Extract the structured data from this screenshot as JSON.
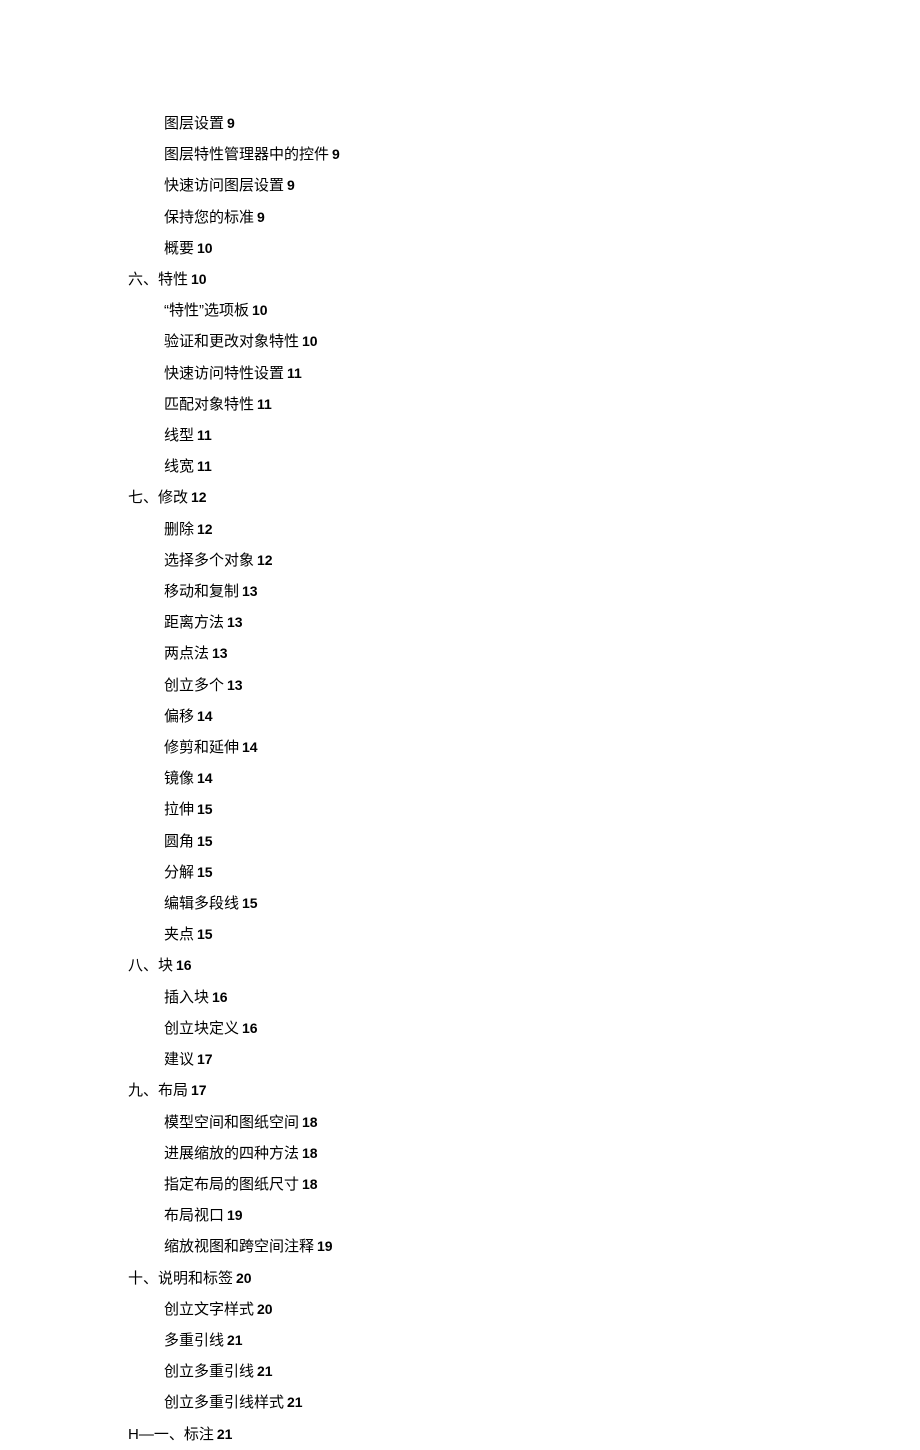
{
  "entries": [
    {
      "level": 1,
      "title": "图层设置",
      "page": "9"
    },
    {
      "level": 1,
      "title": "图层特性管理器中的控件",
      "page": "9"
    },
    {
      "level": 1,
      "title": "快速访问图层设置",
      "page": "9"
    },
    {
      "level": 1,
      "title": "保持您的标准",
      "page": "9"
    },
    {
      "level": 1,
      "title": "概要",
      "page": "10"
    },
    {
      "level": 0,
      "title": "六、特性",
      "page": "10"
    },
    {
      "level": 1,
      "title": "“特性”选项板",
      "page": "10"
    },
    {
      "level": 1,
      "title": "验证和更改对象特性",
      "page": "10"
    },
    {
      "level": 1,
      "title": "快速访问特性设置",
      "page": "11"
    },
    {
      "level": 1,
      "title": "匹配对象特性",
      "page": "11"
    },
    {
      "level": 1,
      "title": "线型",
      "page": "11"
    },
    {
      "level": 1,
      "title": "线宽",
      "page": "11"
    },
    {
      "level": 0,
      "title": "七、修改",
      "page": "12"
    },
    {
      "level": 1,
      "title": "删除",
      "page": "12"
    },
    {
      "level": 1,
      "title": "选择多个对象",
      "page": "12"
    },
    {
      "level": 1,
      "title": "移动和复制",
      "page": "13"
    },
    {
      "level": 1,
      "title": "距离方法",
      "page": "13"
    },
    {
      "level": 1,
      "title": "两点法",
      "page": "13"
    },
    {
      "level": 1,
      "title": "创立多个",
      "page": "13"
    },
    {
      "level": 1,
      "title": "偏移",
      "page": "14"
    },
    {
      "level": 1,
      "title": "修剪和延伸",
      "page": "14"
    },
    {
      "level": 1,
      "title": "镜像",
      "page": "14"
    },
    {
      "level": 1,
      "title": "拉伸",
      "page": "15"
    },
    {
      "level": 1,
      "title": "圆角",
      "page": "15"
    },
    {
      "level": 1,
      "title": "分解",
      "page": "15"
    },
    {
      "level": 1,
      "title": "编辑多段线",
      "page": "15"
    },
    {
      "level": 1,
      "title": "夹点",
      "page": "15"
    },
    {
      "level": 0,
      "title": "八、块",
      "page": "16"
    },
    {
      "level": 1,
      "title": "插入块",
      "page": "16"
    },
    {
      "level": 1,
      "title": "创立块定义",
      "page": "16"
    },
    {
      "level": 1,
      "title": "建议",
      "page": "17"
    },
    {
      "level": 0,
      "title": "九、布局",
      "page": "17"
    },
    {
      "level": 1,
      "title": "模型空间和图纸空间",
      "page": "18"
    },
    {
      "level": 1,
      "title": "进展缩放的四种方法",
      "page": "18"
    },
    {
      "level": 1,
      "title": "指定布局的图纸尺寸",
      "page": "18"
    },
    {
      "level": 1,
      "title": "布局视口",
      "page": "19"
    },
    {
      "level": 1,
      "title": "缩放视图和跨空间注释",
      "page": "19"
    },
    {
      "level": 0,
      "title": "十、说明和标签",
      "page": "20"
    },
    {
      "level": 1,
      "title": "创立文字样式",
      "page": "20"
    },
    {
      "level": 1,
      "title": "多重引线",
      "page": "21"
    },
    {
      "level": 1,
      "title": "创立多重引线",
      "page": "21"
    },
    {
      "level": 1,
      "title": "创立多重引线样式",
      "page": "21"
    },
    {
      "level": 0,
      "title": "H—一、标注",
      "page": "21"
    }
  ]
}
